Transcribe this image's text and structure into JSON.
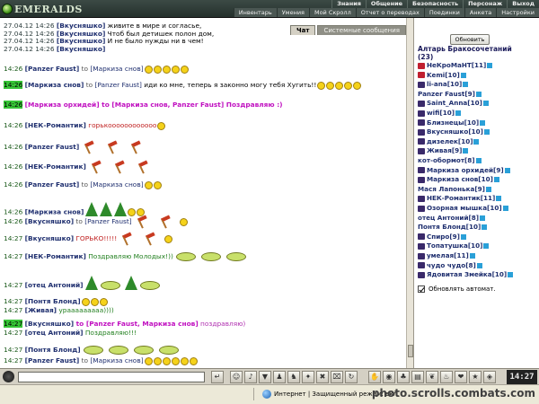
{
  "header": {
    "logo_text": "EMERALDS",
    "nav_top": [
      "Знания",
      "Общение",
      "Безопасность",
      "Персонаж",
      "Выход"
    ],
    "nav_bottom": [
      "Инвентарь",
      "Умения",
      "Мой Скролл",
      "Отчет о переводах",
      "Поединки",
      "Анкета",
      "Настройки"
    ]
  },
  "tabs": {
    "chat": "Чат",
    "system": "Системные сообщения"
  },
  "chat": {
    "old": [
      {
        "ts": "27.04.12 14:26",
        "nick": "[Вкусняшко]",
        "text": " живите в мире и согласье,"
      },
      {
        "ts": "27.04.12 14:26",
        "nick": "[Вкусняшко]",
        "text": " Чтоб был детишек полон дом,"
      },
      {
        "ts": "27.04.12 14:26",
        "nick": "[Вкусняшко]",
        "text": " И не было нужды ни в чем!"
      },
      {
        "ts": "27.04.12 14:26",
        "nick": "[Вкусняшко]",
        "text": ""
      }
    ],
    "messages": [
      {
        "ts": "14:26",
        "nick": "[Panzer Faust]",
        "to": " to ",
        "target": "[Маркиза снов]",
        "text": ""
      },
      {
        "ts": "14:26",
        "nick": "[Маркиза снов]",
        "to": " to ",
        "target": "[Panzer Faust]",
        "text": " иди ко мне, теперь я законно могу тебя Хугить!!"
      },
      {
        "ts": "14:26",
        "nick": "[Маркиза орхидей]",
        "to": " to ",
        "target": "[Маркиза снов, Panzer Faust]",
        "text": " Поздравляю :)"
      },
      {
        "ts": "14:26",
        "nick": "[НЕК-Романтик]",
        "text": " горькоооооооооооо"
      },
      {
        "ts": "14:26",
        "nick": "[Panzer Faust]",
        "text": ""
      },
      {
        "ts": "14:26",
        "nick": "[НЕК-Романтик]",
        "text": ""
      },
      {
        "ts": "14:26",
        "nick": "[Panzer Faust]",
        "to": " to ",
        "target": "[Маркиза снов]",
        "text": ""
      },
      {
        "ts": "14:26",
        "nick": "[Маркиза снов]",
        "text": ""
      },
      {
        "ts": "14:26",
        "nick": "[Вкусняшко]",
        "to": " to ",
        "target": "[Panzer Faust]",
        "text": ""
      },
      {
        "ts": "14:27",
        "nick": "[Вкусняшко]",
        "text": " ГОРЬКО!!!!!"
      },
      {
        "ts": "14:27",
        "nick": "[НЕК-Романтик]",
        "text": " Поздравляю Молодых!))"
      },
      {
        "ts": "14:27",
        "nick": "[отец Антоний]",
        "text": ""
      },
      {
        "ts": "14:27",
        "nick": "[Понтя Блонд]",
        "text": ""
      },
      {
        "ts": "14:27",
        "nick": "[Живая]",
        "text": " урааааааааа))))"
      },
      {
        "ts": "14:27",
        "nick": "[Вкусняшко]",
        "to": " to ",
        "target": "[Panzer Faust, Маркиза снов]",
        "text": " поздравляю)"
      },
      {
        "ts": "14:27",
        "nick": "[отец Антоний]",
        "text": " Поздравляю!!!"
      },
      {
        "ts": "14:27",
        "nick": "[Понтя Блонд]",
        "text": ""
      },
      {
        "ts": "14:27",
        "nick": "[Panzer Faust]",
        "to": " to ",
        "target": "[Маркиза снов]",
        "text": ""
      }
    ]
  },
  "side": {
    "refresh": "Обновить",
    "room_title": "Алтарь Бракосочетаний",
    "room_count": "(23)",
    "users": [
      "НеКроМаНТ[11]",
      "Kemi[10]",
      "li-ana[10]",
      "Panzer Faust[9]",
      "Saint_Anna[10]",
      "wifi[10]",
      "Близнецы[10]",
      "Вкусняшко[10]",
      "дизелек[10]",
      "Живая[9]",
      "кот-обормот[8]",
      "Маркиза орхидей[9]",
      "Маркиза снов[10]",
      "Мася Лапонька[9]",
      "НЕК-Романтик[11]",
      "Озорная мышка[10]",
      "отец Антоний[8]",
      "Понтя Блонд[10]",
      "Спиро[9]",
      "Топатушка[10]",
      "умелая[11]",
      "чудо чудо[8]",
      "Ядовитая Змейка[10]"
    ],
    "auto_refresh": "Обновлять автомат."
  },
  "toolbar": {
    "clock": "14:27"
  },
  "status": {
    "text": "Интернет | Защищенный режим: вкл.",
    "watermark": "photo.scrolls.combats.com"
  }
}
